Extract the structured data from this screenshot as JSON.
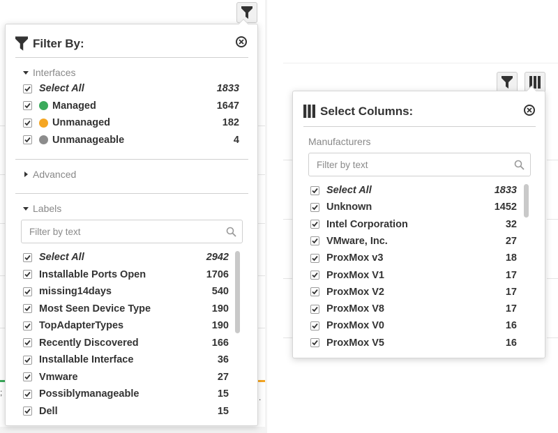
{
  "filter_panel": {
    "title": "Filter By:",
    "interfaces": {
      "header": "Interfaces",
      "items": [
        {
          "label": "Select All",
          "count": "1833",
          "italic": true,
          "dot": null
        },
        {
          "label": "Managed",
          "count": "1647",
          "italic": false,
          "dot": "#3aaa5b"
        },
        {
          "label": "Unmanaged",
          "count": "182",
          "italic": false,
          "dot": "#f5a623"
        },
        {
          "label": "Unmanageable",
          "count": "4",
          "italic": false,
          "dot": "#8c8c8c"
        }
      ]
    },
    "advanced": {
      "header": "Advanced"
    },
    "labels": {
      "header": "Labels",
      "search_placeholder": "Filter by text",
      "items": [
        {
          "label": "Select All",
          "count": "2942",
          "italic": true
        },
        {
          "label": "Installable Ports Open",
          "count": "1706",
          "italic": false
        },
        {
          "label": "missing14days",
          "count": "540",
          "italic": false
        },
        {
          "label": "Most Seen Device Type",
          "count": "190",
          "italic": false
        },
        {
          "label": "TopAdapterTypes",
          "count": "190",
          "italic": false
        },
        {
          "label": "Recently Discovered",
          "count": "166",
          "italic": false
        },
        {
          "label": "Installable Interface",
          "count": "36",
          "italic": false
        },
        {
          "label": "Vmware",
          "count": "27",
          "italic": false
        },
        {
          "label": "Possiblymanageable",
          "count": "15",
          "italic": false
        },
        {
          "label": "Dell",
          "count": "15",
          "italic": false
        }
      ]
    }
  },
  "columns_panel": {
    "title": "Select Columns:",
    "section": "Manufacturers",
    "search_placeholder": "Filter by text",
    "items": [
      {
        "label": "Select All",
        "count": "1833",
        "italic": true
      },
      {
        "label": "Unknown",
        "count": "1452",
        "italic": false
      },
      {
        "label": "Intel Corporation",
        "count": "32",
        "italic": false
      },
      {
        "label": "VMware, Inc.",
        "count": "27",
        "italic": false
      },
      {
        "label": "ProxMox v3",
        "count": "18",
        "italic": false
      },
      {
        "label": "ProxMox V1",
        "count": "17",
        "italic": false
      },
      {
        "label": "ProxMox V2",
        "count": "17",
        "italic": false
      },
      {
        "label": "ProxMox V8",
        "count": "17",
        "italic": false
      },
      {
        "label": "ProxMox V0",
        "count": "16",
        "italic": false
      },
      {
        "label": "ProxMox V5",
        "count": "16",
        "italic": false
      }
    ]
  },
  "icons": {
    "filter": "filter-icon",
    "columns": "columns-icon",
    "close": "close-circle-icon",
    "search": "search-icon",
    "checkbox": "checkbox-checked-icon"
  },
  "colors": {
    "managed": "#3aaa5b",
    "unmanaged": "#f5a623",
    "unmanageable": "#8c8c8c"
  }
}
